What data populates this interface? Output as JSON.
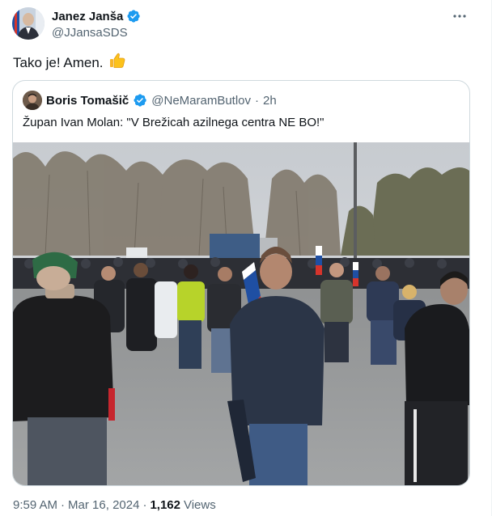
{
  "author": {
    "name": "Janez Janša",
    "handle": "@JJansaSDS"
  },
  "tweet": {
    "text": "Tako je! Amen.",
    "emoji": "👍"
  },
  "quoted": {
    "name": "Boris Tomašič",
    "handle": "@NeMaramButlov",
    "separator": "·",
    "age": "2h",
    "text": "Župan Ivan Molan: \"V Brežicah azilnega centra NE BO!\""
  },
  "footer": {
    "time": "9:59 AM",
    "separator1": "·",
    "date": "Mar 16, 2024",
    "separator2": "·",
    "views_count": "1,162",
    "views_label": "Views"
  },
  "colors": {
    "verified": "#1d9bf0",
    "secondary_text": "#536471",
    "border": "#cfd9de"
  },
  "icons": [
    "verified-badge-icon",
    "more-options-icon",
    "thumbs-up-icon"
  ]
}
